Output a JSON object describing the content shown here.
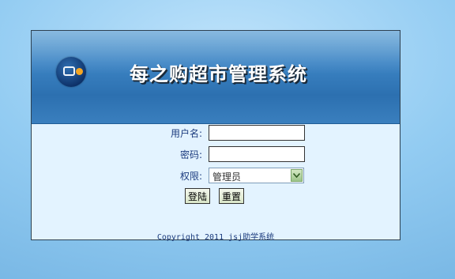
{
  "header": {
    "title": "每之购超市管理系统"
  },
  "form": {
    "username_label": "用户名:",
    "username_value": "",
    "password_label": "密码:",
    "password_value": "",
    "role_label": "权限:",
    "role_selected": "管理员"
  },
  "buttons": {
    "login": "登陆",
    "reset": "重置"
  },
  "footer": {
    "copyright": "Copyright 2011 jsj助学系统"
  },
  "icons": {
    "logo": "app-logo-icon",
    "dropdown": "chevron-down-icon"
  }
}
